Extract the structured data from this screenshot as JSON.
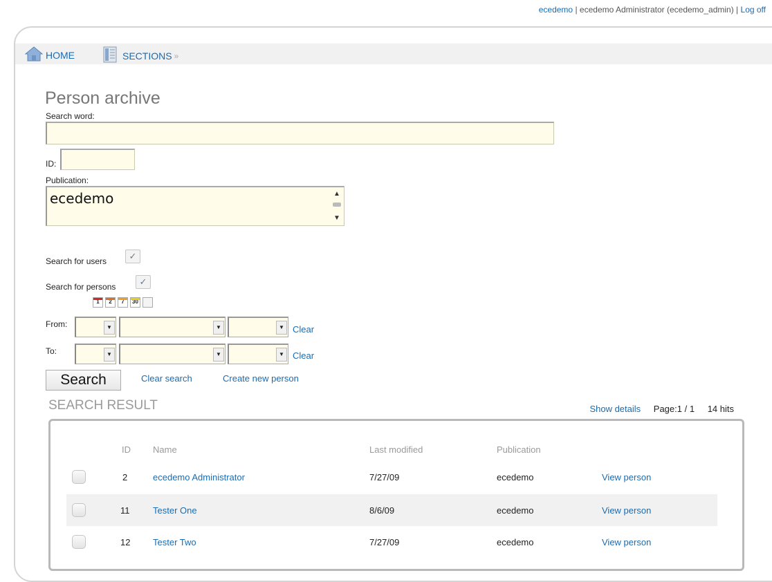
{
  "userbar": {
    "user_link": "ecedemo",
    "sep1": "|",
    "full_name": "ecedemo Administrator (ecedemo_admin)",
    "sep2": "|",
    "logoff": "Log off"
  },
  "nav": {
    "home": "HOME",
    "sections": "SECTIONS",
    "sections_suffix": "»"
  },
  "page": {
    "title": "Person archive"
  },
  "form": {
    "search_word_label": "Search word:",
    "search_word_value": "",
    "id_label": "ID:",
    "id_value": "",
    "publication_label": "Publication:",
    "publication_value": "ecedemo",
    "search_users_label": "Search for users",
    "search_users_checked": true,
    "search_persons_label": "Search for persons",
    "search_persons_checked": true,
    "calendar_shortcuts": [
      "1",
      "2",
      "7",
      "30",
      ""
    ],
    "from_label": "From:",
    "to_label": "To:",
    "clear_label": "Clear",
    "search_button": "Search",
    "clear_search": "Clear search",
    "create_new_person": "Create new person"
  },
  "results": {
    "title": "SEARCH RESULT",
    "show_details": "Show details",
    "page_info": "Page:1 / 1",
    "hits": "14 hits",
    "columns": [
      "ID",
      "Name",
      "Last modified",
      "Publication"
    ],
    "rows": [
      {
        "id": "2",
        "name": "ecedemo Administrator",
        "modified": "7/27/09",
        "publication": "ecedemo",
        "action": "View person"
      },
      {
        "id": "11",
        "name": "Tester One",
        "modified": "8/6/09",
        "publication": "ecedemo",
        "action": "View person"
      },
      {
        "id": "12",
        "name": "Tester Two",
        "modified": "7/27/09",
        "publication": "ecedemo",
        "action": "View person"
      }
    ]
  }
}
